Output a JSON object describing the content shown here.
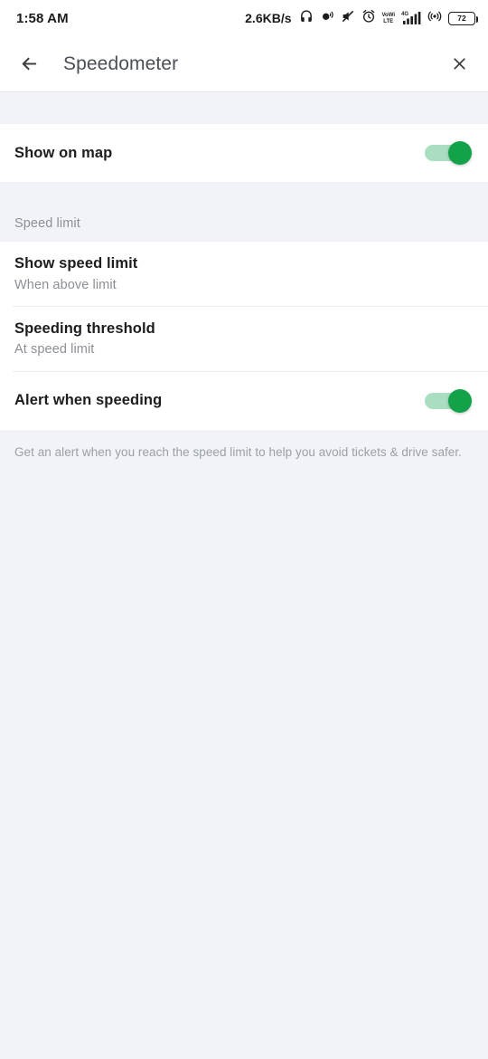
{
  "status_bar": {
    "time": "1:58 AM",
    "network_speed": "2.6KB/s",
    "battery_level": "72",
    "icons": [
      "headphones-icon",
      "vibrate-icon",
      "mute-icon",
      "alarm-icon",
      "volte-icon",
      "signal-bars-icon",
      "hotspot-icon",
      "battery-icon"
    ],
    "volte_label_top": "VoWi",
    "volte_label_bottom": "LTE",
    "network_type": "4G"
  },
  "toolbar": {
    "title": "Speedometer",
    "back_icon": "back-arrow-icon",
    "close_icon": "close-icon"
  },
  "settings": {
    "show_on_map": {
      "title": "Show on map",
      "enabled": true
    },
    "speed_limit_section": {
      "header": "Speed limit",
      "items": [
        {
          "title": "Show speed limit",
          "subtitle": "When above limit"
        },
        {
          "title": "Speeding threshold",
          "subtitle": "At speed limit"
        }
      ]
    },
    "alert_when_speeding": {
      "title": "Alert when speeding",
      "enabled": true
    },
    "footer_note": "Get an alert when you reach the speed limit to help you avoid tickets & drive safer."
  },
  "colors": {
    "accent_green": "#13a24a",
    "track_green": "#a9dfc0",
    "page_background": "#f1f3f8",
    "card_background": "#ffffff",
    "title_text": "#1d1d1d",
    "secondary_text": "#8b9096"
  }
}
